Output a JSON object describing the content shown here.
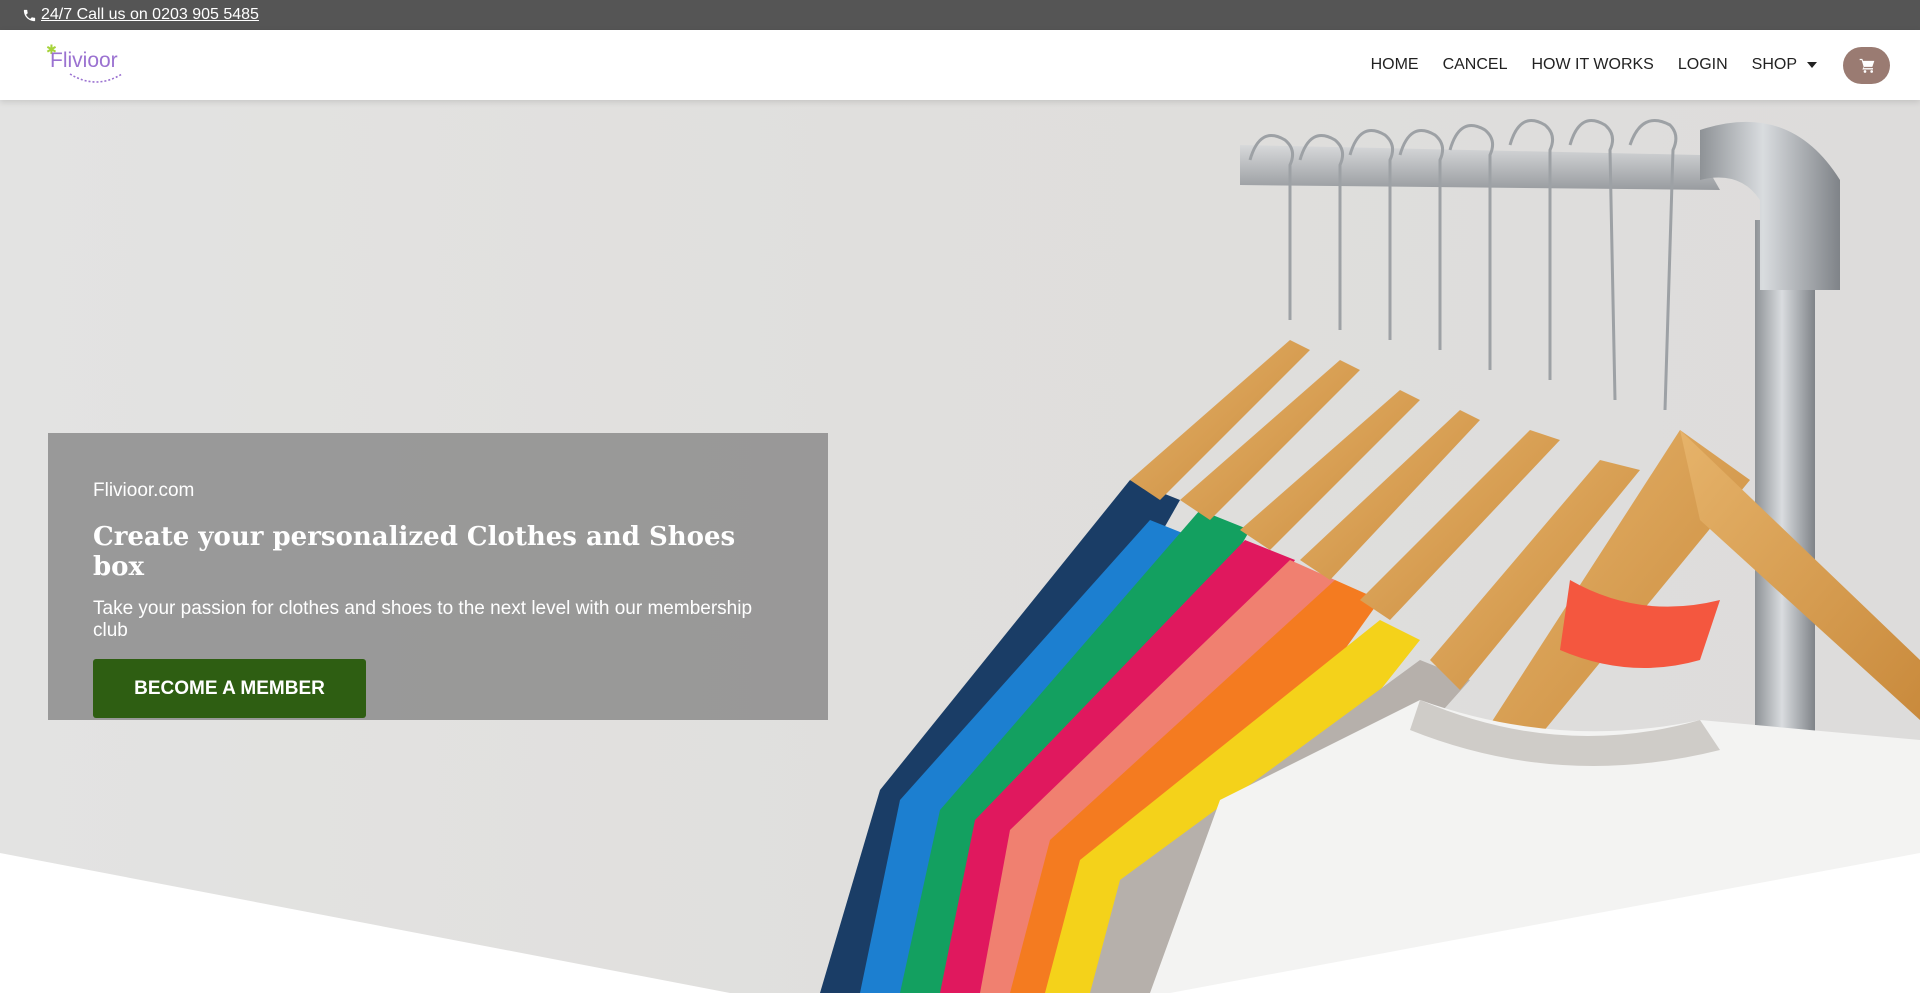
{
  "topbar": {
    "phone_label": "24/7 Call us on 0203 905 5485"
  },
  "header": {
    "logo_text": "Flivioor",
    "nav": [
      {
        "label": "HOME"
      },
      {
        "label": "CANCEL"
      },
      {
        "label": "HOW IT WORKS"
      },
      {
        "label": "LOGIN"
      },
      {
        "label": "SHOP"
      }
    ],
    "cart_icon": "shopping-cart-icon"
  },
  "hero": {
    "eyebrow": "Flivioor.com",
    "title": "Create your personalized Clothes and Shoes box",
    "subtitle": "Take your passion for clothes and shoes to the next level with our membership club",
    "cta_label": "BECOME A MEMBER"
  },
  "colors": {
    "topbar": "#555555",
    "cta": "#2e5e12",
    "cart": "#9a7b72",
    "logo": "#9b72d1"
  }
}
